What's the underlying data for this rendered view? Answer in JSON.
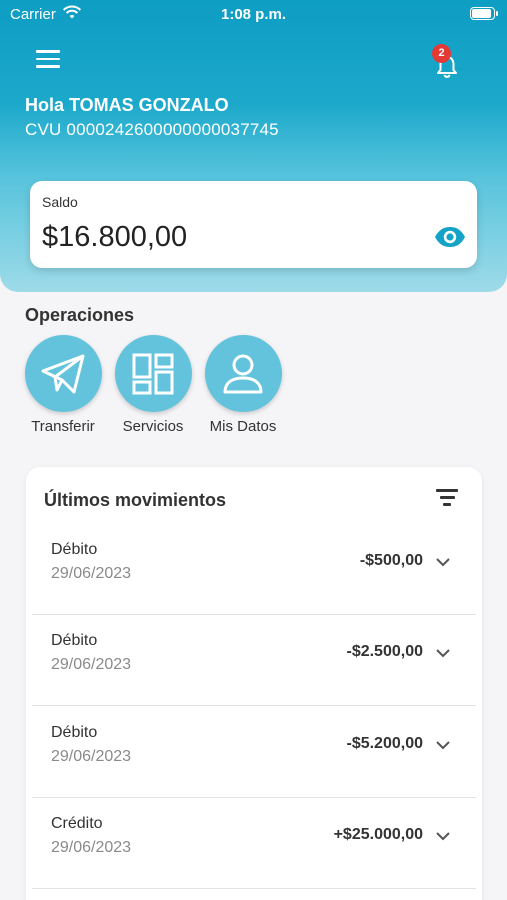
{
  "status_bar": {
    "carrier": "Carrier",
    "time": "1:08 p.m."
  },
  "header": {
    "notifications_count": "2",
    "greeting": "Hola TOMAS GONZALO",
    "cvu": "CVU 0000242600000000037745"
  },
  "balance": {
    "label": "Saldo",
    "amount": "$16.800,00"
  },
  "operations": {
    "title": "Operaciones",
    "items": [
      {
        "label": "Transferir",
        "icon": "paper-plane-icon"
      },
      {
        "label": "Servicios",
        "icon": "grid-icon"
      },
      {
        "label": "Mis Datos",
        "icon": "user-icon"
      }
    ]
  },
  "movements": {
    "title": "Últimos movimientos",
    "items": [
      {
        "type": "Débito",
        "date": "29/06/2023",
        "amount": "-$500,00"
      },
      {
        "type": "Débito",
        "date": "29/06/2023",
        "amount": "-$2.500,00"
      },
      {
        "type": "Débito",
        "date": "29/06/2023",
        "amount": "-$5.200,00"
      },
      {
        "type": "Crédito",
        "date": "29/06/2023",
        "amount": "+$25.000,00"
      }
    ]
  },
  "colors": {
    "accent": "#14a3c7",
    "icon_circle": "#63c3dc",
    "badge": "#e53935"
  }
}
